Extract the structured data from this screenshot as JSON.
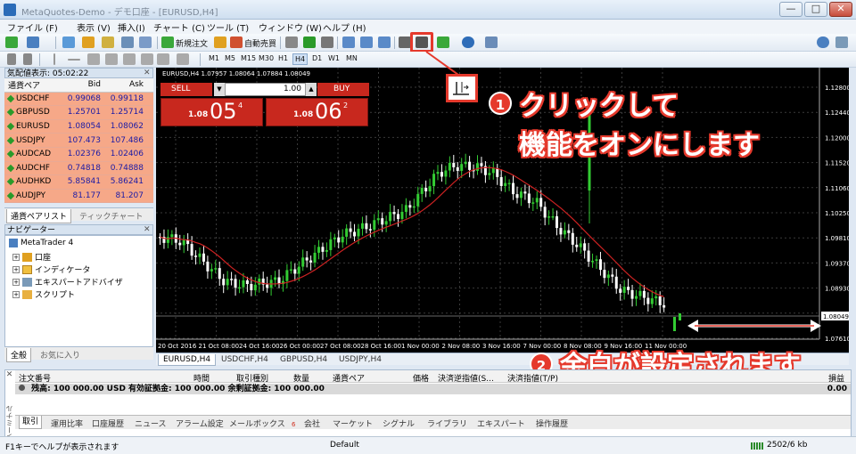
{
  "window": {
    "title": "MetaQuotes-Demo - デモ口座 - [EURUSD,H4]",
    "minimize": "—",
    "maximize": "□",
    "close": "✕"
  },
  "menu": [
    "ファイル (F)",
    "表示 (V)",
    "挿入(I)",
    "チャート (C)",
    "ツール (T)",
    "ウィンドウ (W)",
    "ヘルプ (H)"
  ],
  "toolbar": {
    "new_order": "新規注文",
    "auto_trade": "自動売買"
  },
  "timeframes": [
    "M1",
    "M5",
    "M15",
    "M30",
    "H1",
    "H4",
    "D1",
    "W1",
    "MN"
  ],
  "market_watch": {
    "header": "気配値表示: 05:02:22",
    "columns": [
      "通貨ペア",
      "Bid",
      "Ask"
    ],
    "rows": [
      {
        "symbol": "USDCHF",
        "bid": "0.99068",
        "ask": "0.99118"
      },
      {
        "symbol": "GBPUSD",
        "bid": "1.25701",
        "ask": "1.25714"
      },
      {
        "symbol": "EURUSD",
        "bid": "1.08054",
        "ask": "1.08062"
      },
      {
        "symbol": "USDJPY",
        "bid": "107.473",
        "ask": "107.486"
      },
      {
        "symbol": "AUDCAD",
        "bid": "1.02376",
        "ask": "1.02406"
      },
      {
        "symbol": "AUDCHF",
        "bid": "0.74818",
        "ask": "0.74888"
      },
      {
        "symbol": "AUDHKD",
        "bid": "5.85841",
        "ask": "5.86241"
      },
      {
        "symbol": "AUDJPY",
        "bid": "81.177",
        "ask": "81.207"
      }
    ],
    "tabs": [
      "通貨ペアリスト",
      "ティックチャート"
    ]
  },
  "navigator": {
    "header": "ナビゲーター",
    "root": "MetaTrader 4",
    "items": [
      "口座",
      "インディケータ",
      "エキスパートアドバイザ",
      "スクリプト"
    ],
    "tabs": [
      "全般",
      "お気に入り"
    ]
  },
  "chart": {
    "info": "EURUSD,H4  1.07957 1.08064 1.07884 1.08049",
    "one_click": {
      "sell": "SELL",
      "buy": "BUY",
      "lot": "1.00",
      "bid_small": "1.08",
      "bid_big": "05",
      "bid_sup": "4",
      "ask_small": "1.08",
      "ask_big": "06",
      "ask_sup": "2"
    },
    "price_labels": [
      "1.12800",
      "1.12440",
      "1.12000",
      "1.11520",
      "1.11060",
      "1.10250",
      "1.09810",
      "1.09370",
      "1.08930",
      "1.08049",
      "1.07610"
    ],
    "current_price": "1.08049",
    "time_labels": [
      "20 Oct 2016",
      "21 Oct 08:00",
      "24 Oct 16:00",
      "26 Oct 00:00",
      "27 Oct 08:00",
      "28 Oct 16:00",
      "1 Nov 00:00",
      "2 Nov 08:00",
      "3 Nov 16:00",
      "7 Nov 00:00",
      "8 Nov 08:00",
      "9 Nov 16:00",
      "11 Nov 00:00"
    ],
    "tabs": [
      "EURUSD,H4",
      "USDCHF,H4",
      "GBPUSD,H4",
      "USDJPY,H4"
    ]
  },
  "annotations": {
    "step1_num": "1",
    "step1_line1": "クリックして",
    "step1_line2": "機能をオンにします",
    "step2_num": "2",
    "step2_text": "余白が設定されます"
  },
  "terminal": {
    "columns": [
      "注文番号",
      "時間",
      "取引種別",
      "数量",
      "通貨ペア",
      "価格",
      "決済逆指値(S...",
      "決済指値(T/P)",
      "損益"
    ],
    "balance": "残高: 100 000.00 USD  有効証拠金: 100 000.00  余剰証拠金: 100 000.00",
    "balance_pl": "0.00",
    "side_label": "ターミナル",
    "tabs": [
      "取引",
      "運用比率",
      "口座履歴",
      "ニュース",
      "アラーム設定",
      "メールボックス",
      "会社",
      "マーケット",
      "シグナル",
      "ライブラリ",
      "エキスパート",
      "操作履歴"
    ],
    "mailbox_badge": "6"
  },
  "status": {
    "help": "F1キーでヘルプが表示されます",
    "profile": "Default",
    "traffic": "2502/6 kb"
  },
  "colors": {
    "bull": "#33cc33",
    "bear": "#ffffff",
    "ma": "#cc2222",
    "accent": "#e5392c"
  }
}
